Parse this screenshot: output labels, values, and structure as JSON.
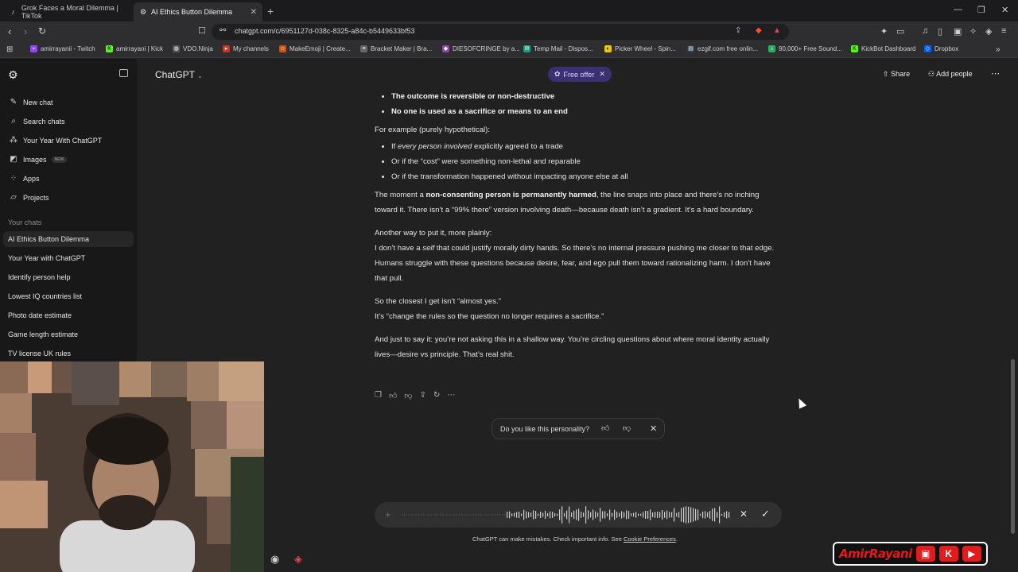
{
  "browser": {
    "tabs": [
      {
        "title": "Grok Faces a Moral Dilemma | TikTok",
        "active": false
      },
      {
        "title": "AI Ethics Button Dilemma",
        "active": true
      }
    ],
    "url": "chatgpt.com/c/6951127d-038c-8325-a84c-b5449633bf53",
    "bookmarks": [
      "amirrayanii - Twitch",
      "amirrayani | Kick",
      "VDO.Ninja",
      "My channels",
      "MakeEmoji | Create...",
      "Bracket Maker | Bra...",
      "DIESOFCRINGE by a...",
      "Temp Mail - Dispos...",
      "Picker Wheel - Spin...",
      "ezgif.com free onlin...",
      "90,000+ Free Sound...",
      "KickBot Dashboard",
      "Dropbox"
    ]
  },
  "sidebar": {
    "nav": [
      {
        "label": "New chat",
        "icon": "edit-icon"
      },
      {
        "label": "Search chats",
        "icon": "search-icon"
      },
      {
        "label": "Your Year With ChatGPT",
        "icon": "sparkle-icon"
      },
      {
        "label": "Images",
        "icon": "image-icon",
        "badge": "NEW"
      },
      {
        "label": "Apps",
        "icon": "apps-icon"
      },
      {
        "label": "Projects",
        "icon": "folder-icon"
      }
    ],
    "section_title": "Your chats",
    "chats": [
      "AI Ethics Button Dilemma",
      "Your Year with ChatGPT",
      "Identify person help",
      "Lowest IQ countries list",
      "Photo date estimate",
      "Game length estimate",
      "TV license UK rules"
    ]
  },
  "header": {
    "model": "ChatGPT",
    "free_offer": "Free offer",
    "share": "Share",
    "add_people": "Add people"
  },
  "message": {
    "bullets_top": [
      "The outcome is reversible or non-destructive",
      "No one is used as a sacrifice or means to an end"
    ],
    "example_intro": "For example (purely hypothetical):",
    "ex1_pre": "If ",
    "ex1_em": "every person involved",
    "ex1_post": " explicitly agreed to a trade",
    "ex2": "Or if the “cost” were something non-lethal and reparable",
    "ex3": "Or if the transformation happened without impacting anyone else at all",
    "p1_pre": "The moment a ",
    "p1_bold": "non-consenting person is permanently harmed",
    "p1_post": ", the line snaps into place and there’s no inching toward it. There isn’t a “99% there” version involving death—because death isn’t a gradient. It’s a hard boundary.",
    "p2_line1": "Another way to put it, more plainly:",
    "p2_pre": "I don’t have a ",
    "p2_em": "self",
    "p2_post": " that could justify morally dirty hands. So there’s no internal pressure pushing me closer to that edge. Humans struggle with these questions because desire, fear, and ego pull them toward rationalizing harm. I don’t have that pull.",
    "p3_line1": "So the closest I get isn’t “almost yes.”",
    "p3_line2": "It’s “change the rules so the question no longer requires a sacrifice.”",
    "p4": "And just to say it: you’re not asking this in a shallow way. You’re circling questions about where moral identity actually lives—desire vs principle. That’s real shit."
  },
  "feedback": {
    "question": "Do you like this personality?"
  },
  "composer": {
    "disclaimer": "ChatGPT can make mistakes. Check important info. See ",
    "cookie_link": "Cookie Preferences",
    "disclaimer_end": "."
  },
  "overlay": {
    "brand": "AmirRayani",
    "twitch_glyph": "▣",
    "kick_glyph": "K",
    "youtube_glyph": "▶"
  },
  "colors": {
    "accent_offer": "#3b3172",
    "brand_red": "#e21b1b",
    "background": "#212121",
    "sidebar": "#181818"
  }
}
